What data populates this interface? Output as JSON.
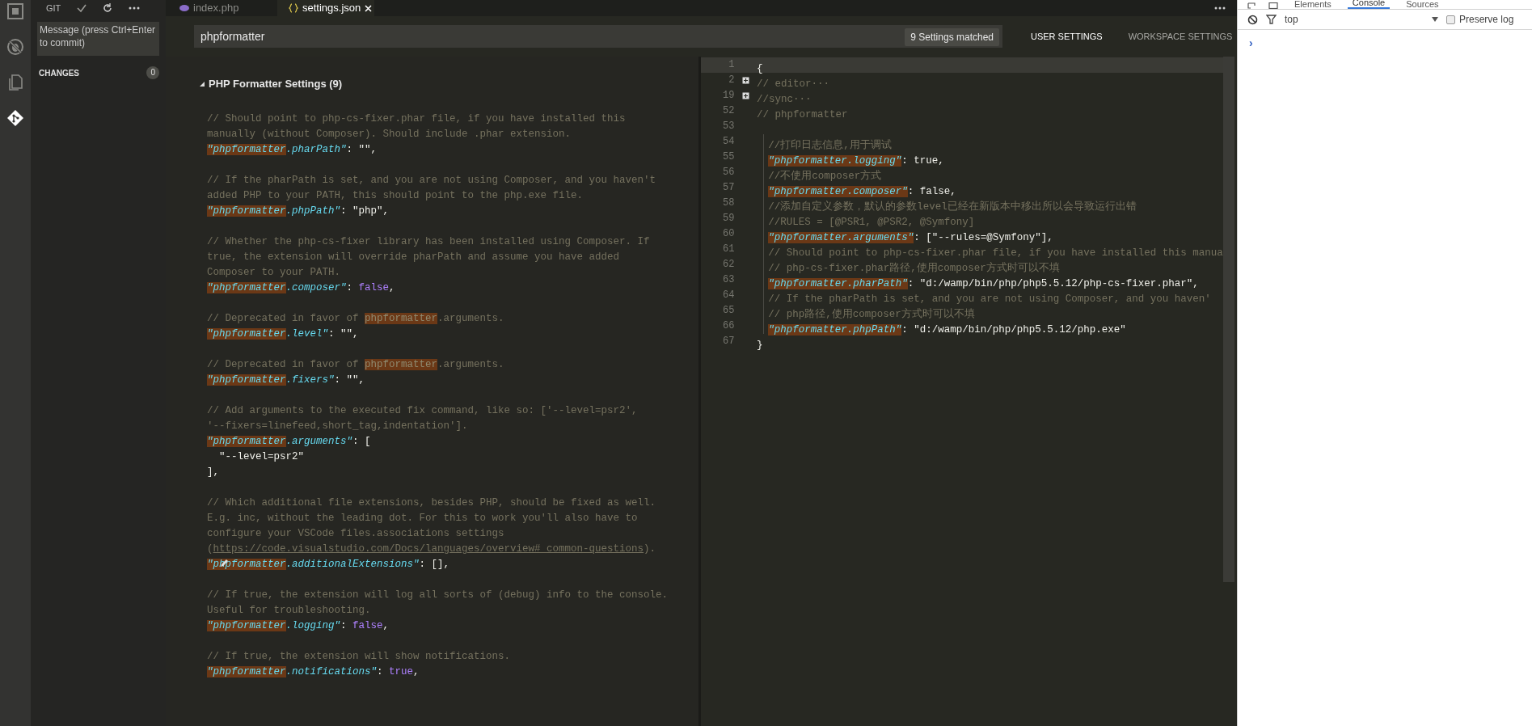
{
  "activity_bar": [
    {
      "kind": "box",
      "selected": false
    },
    {
      "kind": "bug",
      "selected": false
    },
    {
      "kind": "files",
      "selected": false
    },
    {
      "kind": "git",
      "selected": true
    }
  ],
  "scm": {
    "title": "GIT",
    "commit_message": {
      "placeholder": "Message (press Ctrl+Enter to commit)"
    },
    "changes": {
      "label": "CHANGES",
      "count": "0"
    }
  },
  "tabs": [
    {
      "label": "index.php",
      "kind": "php",
      "selected": false
    },
    {
      "label": "settings.json",
      "kind": "json",
      "selected": true
    }
  ],
  "search": {
    "value": "phpformatter",
    "match_count": "9 Settings matched"
  },
  "settings_tabs": [
    {
      "label": "USER SETTINGS",
      "selected": true
    },
    {
      "label": "WORKSPACE SETTINGS",
      "selected": false
    }
  ],
  "defaults_pane": {
    "section": {
      "title": "PHP Formatter Settings (9)",
      "expanded": true
    },
    "blocks": [
      {
        "pencil": false,
        "lines": [
          [
            {
              "kind": "comment",
              "text": "// Should point to php-cs-fixer.phar file, if you have installed this"
            }
          ],
          [
            {
              "kind": "comment",
              "text": "manually (without Composer). Should include .phar extension."
            }
          ],
          [
            {
              "kind": "key_match",
              "text": "\"phpformatter"
            },
            {
              "kind": "key",
              "text": ".pharPath\""
            },
            {
              "kind": "value",
              "text": ": \"\","
            }
          ]
        ]
      },
      {
        "pencil": false,
        "lines": [
          [
            {
              "kind": "comment",
              "text": "// If the pharPath is set, and you are not using Composer, and you haven't"
            }
          ],
          [
            {
              "kind": "comment",
              "text": "added PHP to your PATH, this should point to the php.exe file."
            }
          ],
          [
            {
              "kind": "key_match",
              "text": "\"phpformatter"
            },
            {
              "kind": "key",
              "text": ".phpPath\""
            },
            {
              "kind": "value",
              "text": ": \"php\","
            }
          ]
        ]
      },
      {
        "pencil": false,
        "lines": [
          [
            {
              "kind": "comment",
              "text": "// Whether the php-cs-fixer library has been installed using Composer. If"
            }
          ],
          [
            {
              "kind": "comment",
              "text": "true, the extension will override pharPath and assume you have added"
            }
          ],
          [
            {
              "kind": "comment",
              "text": "Composer to your PATH."
            }
          ],
          [
            {
              "kind": "key_match",
              "text": "\"phpformatter"
            },
            {
              "kind": "key",
              "text": ".composer\""
            },
            {
              "kind": "value",
              "text": ": "
            },
            {
              "kind": "constant",
              "text": "false"
            },
            {
              "kind": "value",
              "text": ","
            }
          ]
        ]
      },
      {
        "pencil": false,
        "lines": [
          [
            {
              "kind": "comment",
              "text": "// Deprecated in favor of "
            },
            {
              "kind": "comment_match",
              "text": "phpformatter"
            },
            {
              "kind": "comment",
              "text": ".arguments."
            }
          ],
          [
            {
              "kind": "key_match",
              "text": "\"phpformatter"
            },
            {
              "kind": "key",
              "text": ".level\""
            },
            {
              "kind": "value",
              "text": ": \"\","
            }
          ]
        ]
      },
      {
        "pencil": false,
        "lines": [
          [
            {
              "kind": "comment",
              "text": "// Deprecated in favor of "
            },
            {
              "kind": "comment_match",
              "text": "phpformatter"
            },
            {
              "kind": "comment",
              "text": ".arguments."
            }
          ],
          [
            {
              "kind": "key_match",
              "text": "\"phpformatter"
            },
            {
              "kind": "key",
              "text": ".fixers\""
            },
            {
              "kind": "value",
              "text": ": \"\","
            }
          ]
        ]
      },
      {
        "pencil": false,
        "lines": [
          [
            {
              "kind": "comment",
              "text": "// Add arguments to the executed fix command, like so: ['--level=psr2',"
            }
          ],
          [
            {
              "kind": "comment",
              "text": "'--fixers=linefeed,short_tag,indentation']."
            }
          ],
          [
            {
              "kind": "key_match",
              "text": "\"phpformatter"
            },
            {
              "kind": "key",
              "text": ".arguments\""
            },
            {
              "kind": "value",
              "text": ": ["
            }
          ],
          [
            {
              "kind": "value",
              "text": "  \"--level=psr2\""
            }
          ],
          [
            {
              "kind": "value",
              "text": "],"
            }
          ]
        ]
      },
      {
        "pencil": true,
        "lines": [
          [
            {
              "kind": "comment",
              "text": "// Which additional file extensions, besides PHP, should be fixed as well."
            }
          ],
          [
            {
              "kind": "comment",
              "text": "E.g. inc, without the leading dot. For this to work you'll also have to"
            }
          ],
          [
            {
              "kind": "comment",
              "text": "configure your VSCode files.associations settings"
            }
          ],
          [
            {
              "kind": "comment",
              "text": "("
            },
            {
              "kind": "link",
              "text": "https://code.visualstudio.com/Docs/languages/overview#_common-questions"
            },
            {
              "kind": "comment",
              "text": ")."
            }
          ],
          [
            {
              "kind": "key_match",
              "text": "\"phpformatter"
            },
            {
              "kind": "key",
              "text": ".additionalExtensions\""
            },
            {
              "kind": "value",
              "text": ": [],"
            }
          ]
        ]
      },
      {
        "pencil": false,
        "lines": [
          [
            {
              "kind": "comment",
              "text": "// If true, the extension will log all sorts of (debug) info to the console."
            }
          ],
          [
            {
              "kind": "comment",
              "text": "Useful for troubleshooting."
            }
          ],
          [
            {
              "kind": "key_match",
              "text": "\"phpformatter"
            },
            {
              "kind": "key",
              "text": ".logging\""
            },
            {
              "kind": "value",
              "text": ": "
            },
            {
              "kind": "constant",
              "text": "false"
            },
            {
              "kind": "value",
              "text": ","
            }
          ]
        ]
      },
      {
        "pencil": false,
        "lines": [
          [
            {
              "kind": "comment",
              "text": "// If true, the extension will show notifications."
            }
          ],
          [
            {
              "kind": "key_match",
              "text": "\"phpformatter"
            },
            {
              "kind": "key",
              "text": ".notifications\""
            },
            {
              "kind": "value",
              "text": ": "
            },
            {
              "kind": "constant",
              "text": "true"
            },
            {
              "kind": "value",
              "text": ","
            }
          ]
        ]
      }
    ]
  },
  "editor": {
    "lines": [
      {
        "number": "1",
        "current": true,
        "folded": false,
        "guide": false,
        "tokens": [
          {
            "kind": "value",
            "text": "{"
          }
        ]
      },
      {
        "number": "2",
        "current": false,
        "folded": true,
        "guide": false,
        "tokens": [
          {
            "kind": "comment",
            "text": "// editor···"
          }
        ]
      },
      {
        "number": "19",
        "current": false,
        "folded": true,
        "guide": false,
        "tokens": [
          {
            "kind": "comment",
            "text": "//sync···"
          }
        ]
      },
      {
        "number": "52",
        "current": false,
        "folded": false,
        "guide": false,
        "tokens": [
          {
            "kind": "comment",
            "text": "// phpformatter"
          }
        ]
      },
      {
        "number": "53",
        "current": false,
        "folded": false,
        "guide": false
      },
      {
        "number": "54",
        "current": false,
        "folded": false,
        "guide": true,
        "tokens": [
          {
            "kind": "comment",
            "text": "//打印日志信息,用于调试"
          }
        ]
      },
      {
        "number": "55",
        "current": false,
        "folded": false,
        "guide": true,
        "tokens": [
          {
            "kind": "key_match",
            "text": "\"phpformatter.logging\""
          },
          {
            "kind": "value",
            "text": ": true,"
          }
        ]
      },
      {
        "number": "56",
        "current": false,
        "folded": false,
        "guide": true,
        "tokens": [
          {
            "kind": "comment",
            "text": "//不使用composer方式"
          }
        ]
      },
      {
        "number": "57",
        "current": false,
        "folded": false,
        "guide": true,
        "tokens": [
          {
            "kind": "key_match",
            "text": "\"phpformatter.composer\""
          },
          {
            "kind": "value",
            "text": ": false,"
          }
        ]
      },
      {
        "number": "58",
        "current": false,
        "folded": false,
        "guide": true,
        "tokens": [
          {
            "kind": "comment",
            "text": "//添加自定义参数，默认的参数level已经在新版本中移出所以会导致运行出错"
          }
        ]
      },
      {
        "number": "59",
        "current": false,
        "folded": false,
        "guide": true,
        "tokens": [
          {
            "kind": "comment",
            "text": "//RULES = [@PSR1, @PSR2, @Symfony]"
          }
        ]
      },
      {
        "number": "60",
        "current": false,
        "folded": false,
        "guide": true,
        "tokens": [
          {
            "kind": "key_match",
            "text": "\"phpformatter.arguments\""
          },
          {
            "kind": "value",
            "text": ": [\"--rules=@Symfony\"],"
          }
        ]
      },
      {
        "number": "61",
        "current": false,
        "folded": false,
        "guide": true,
        "tokens": [
          {
            "kind": "comment",
            "text": "// Should point to php-cs-fixer.phar file, if you have installed this manua"
          }
        ]
      },
      {
        "number": "62",
        "current": false,
        "folded": false,
        "guide": true,
        "tokens": [
          {
            "kind": "comment",
            "text": "// php-cs-fixer.phar路径,使用composer方式时可以不填"
          }
        ]
      },
      {
        "number": "63",
        "current": false,
        "folded": false,
        "guide": true,
        "tokens": [
          {
            "kind": "key_match",
            "text": "\"phpformatter.pharPath\""
          },
          {
            "kind": "value",
            "text": ": \"d:/wamp/bin/php/php5.5.12/php-cs-fixer.phar\","
          }
        ]
      },
      {
        "number": "64",
        "current": false,
        "folded": false,
        "guide": true,
        "tokens": [
          {
            "kind": "comment",
            "text": "// If the pharPath is set, and you are not using Composer, and you haven'"
          }
        ]
      },
      {
        "number": "65",
        "current": false,
        "folded": false,
        "guide": true,
        "tokens": [
          {
            "kind": "comment",
            "text": "// php路径,使用composer方式时可以不填"
          }
        ]
      },
      {
        "number": "66",
        "current": false,
        "folded": false,
        "guide": true,
        "tokens": [
          {
            "kind": "key_match",
            "text": "\"phpformatter.phpPath\""
          },
          {
            "kind": "value",
            "text": ": \"d:/wamp/bin/php/php5.5.12/php.exe\""
          }
        ]
      },
      {
        "number": "67",
        "current": false,
        "folded": false,
        "guide": false,
        "tokens": [
          {
            "kind": "value",
            "text": "}"
          }
        ]
      }
    ]
  },
  "devtools": {
    "tabs": [
      {
        "label": "Elements",
        "selected": false
      },
      {
        "label": "Console",
        "selected": true
      },
      {
        "label": "Sources",
        "selected": false
      }
    ],
    "context": "top",
    "preserve_log": {
      "label": "Preserve log",
      "checked": false
    },
    "prompt": "›"
  }
}
